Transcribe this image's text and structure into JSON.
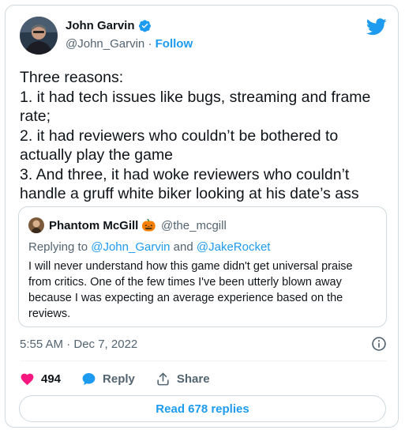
{
  "tweet": {
    "author_name": "John Garvin",
    "author_handle": "@John_Garvin",
    "separator": " · ",
    "follow_label": "Follow",
    "text": "Three reasons:\n1. it had tech issues like bugs, streaming and frame rate;\n2. it had reviewers who couldn’t be bothered to actually play the game\n3. And three, it had woke reviewers who couldn’t handle a gruff white biker looking at his date’s ass",
    "timestamp": "5:55 AM · Dec 7, 2022"
  },
  "quote": {
    "author_name": "Phantom McGill",
    "author_emoji": "🎃",
    "author_handle": "@the_mcgill",
    "replying_prefix": "Replying to ",
    "replying_user1": "@John_Garvin",
    "replying_and": " and ",
    "replying_user2": "@JakeRocket",
    "text": "I will never understand how this game didn't get universal praise from critics. One of the few times I've been utterly blown away because I was expecting an average experience based on the reviews."
  },
  "actions": {
    "like_count": "494",
    "reply_label": "Reply",
    "share_label": "Share"
  },
  "read_replies_label": "Read 678 replies",
  "icons": {
    "brand": "twitter-bird-icon",
    "verified": "verified-badge-icon",
    "info": "info-icon",
    "like": "heart-icon",
    "reply": "speech-bubble-icon",
    "share": "share-upload-icon"
  },
  "colors": {
    "brand_blue": "#1d9bf0",
    "like_pink": "#f91880",
    "text": "#0f1419",
    "secondary": "#536471"
  }
}
